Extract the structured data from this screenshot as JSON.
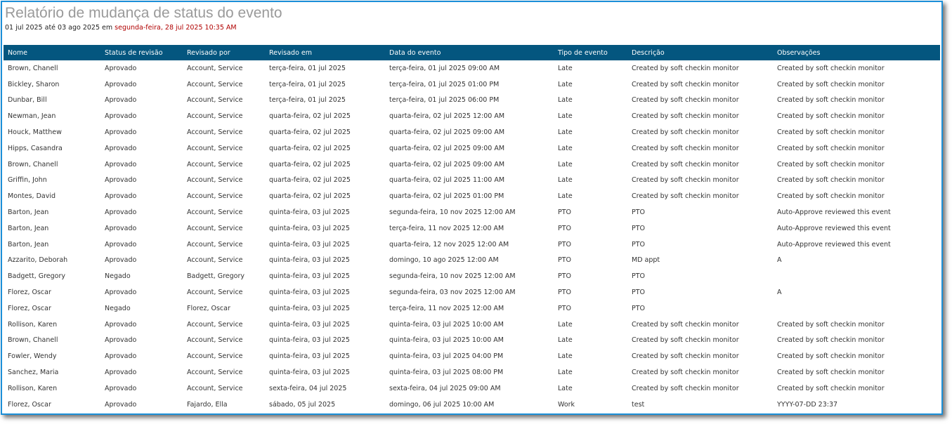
{
  "report": {
    "title": "Relatório de mudança de status do evento",
    "period": "01 jul 2025 até 03 ago 2025 em",
    "generated": "segunda-feira, 28 jul 2025 10:35 AM"
  },
  "colors": {
    "header_bg": "#04567f",
    "frame_border": "#1b8fd8",
    "generated_text": "#b00000",
    "title_text": "#9a9a9a"
  },
  "columns": [
    "Nome",
    "Status de revisão",
    "Revisado por",
    "Revisado em",
    "Data do evento",
    "Tipo de evento",
    "Descrição",
    "Observações"
  ],
  "rows": [
    [
      "Brown, Chanell",
      "Aprovado",
      "Account, Service",
      "terça-feira, 01 jul 2025",
      "terça-feira, 01 jul 2025 09:00 AM",
      "Late",
      "Created by soft checkin monitor",
      "Created by soft checkin monitor"
    ],
    [
      "Bickley, Sharon",
      "Aprovado",
      "Account, Service",
      "terça-feira, 01 jul 2025",
      "terça-feira, 01 jul 2025 01:00 PM",
      "Late",
      "Created by soft checkin monitor",
      "Created by soft checkin monitor"
    ],
    [
      "Dunbar, Bill",
      "Aprovado",
      "Account, Service",
      "terça-feira, 01 jul 2025",
      "terça-feira, 01 jul 2025 06:00 PM",
      "Late",
      "Created by soft checkin monitor",
      "Created by soft checkin monitor"
    ],
    [
      "Newman, Jean",
      "Aprovado",
      "Account, Service",
      "quarta-feira, 02 jul 2025",
      "quarta-feira, 02 jul 2025 12:00 AM",
      "Late",
      "Created by soft checkin monitor",
      "Created by soft checkin monitor"
    ],
    [
      "Houck, Matthew",
      "Aprovado",
      "Account, Service",
      "quarta-feira, 02 jul 2025",
      "quarta-feira, 02 jul 2025 09:00 AM",
      "Late",
      "Created by soft checkin monitor",
      "Created by soft checkin monitor"
    ],
    [
      "Hipps, Casandra",
      "Aprovado",
      "Account, Service",
      "quarta-feira, 02 jul 2025",
      "quarta-feira, 02 jul 2025 09:00 AM",
      "Late",
      "Created by soft checkin monitor",
      "Created by soft checkin monitor"
    ],
    [
      "Brown, Chanell",
      "Aprovado",
      "Account, Service",
      "quarta-feira, 02 jul 2025",
      "quarta-feira, 02 jul 2025 09:00 AM",
      "Late",
      "Created by soft checkin monitor",
      "Created by soft checkin monitor"
    ],
    [
      "Griffin, John",
      "Aprovado",
      "Account, Service",
      "quarta-feira, 02 jul 2025",
      "quarta-feira, 02 jul 2025 11:00 AM",
      "Late",
      "Created by soft checkin monitor",
      "Created by soft checkin monitor"
    ],
    [
      "Montes, David",
      "Aprovado",
      "Account, Service",
      "quarta-feira, 02 jul 2025",
      "quarta-feira, 02 jul 2025 01:00 PM",
      "Late",
      "Created by soft checkin monitor",
      "Created by soft checkin monitor"
    ],
    [
      "Barton, Jean",
      "Aprovado",
      "Account, Service",
      "quinta-feira, 03 jul 2025",
      "segunda-feira, 10 nov 2025 12:00 AM",
      "PTO",
      "PTO",
      "Auto-Approve reviewed this event"
    ],
    [
      "Barton, Jean",
      "Aprovado",
      "Account, Service",
      "quinta-feira, 03 jul 2025",
      "terça-feira, 11 nov 2025 12:00 AM",
      "PTO",
      "PTO",
      "Auto-Approve reviewed this event"
    ],
    [
      "Barton, Jean",
      "Aprovado",
      "Account, Service",
      "quinta-feira, 03 jul 2025",
      "quarta-feira, 12 nov 2025 12:00 AM",
      "PTO",
      "PTO",
      "Auto-Approve reviewed this event"
    ],
    [
      "Azzarito, Deborah",
      "Aprovado",
      "Account, Service",
      "quinta-feira, 03 jul 2025",
      "domingo, 10 ago 2025 12:00 AM",
      "PTO",
      "MD appt",
      "A"
    ],
    [
      "Badgett, Gregory",
      "Negado",
      "Badgett, Gregory",
      "quinta-feira, 03 jul 2025",
      "segunda-feira, 10 nov 2025 12:00 AM",
      "PTO",
      "PTO",
      ""
    ],
    [
      "Florez, Oscar",
      "Aprovado",
      "Account, Service",
      "quinta-feira, 03 jul 2025",
      "segunda-feira, 03 nov 2025 12:00 AM",
      "PTO",
      "PTO",
      "A"
    ],
    [
      "Florez, Oscar",
      "Negado",
      "Florez, Oscar",
      "quinta-feira, 03 jul 2025",
      "terça-feira, 11 nov 2025 12:00 AM",
      "PTO",
      "PTO",
      ""
    ],
    [
      "Rollison, Karen",
      "Aprovado",
      "Account, Service",
      "quinta-feira, 03 jul 2025",
      "quinta-feira, 03 jul 2025 10:00 AM",
      "Late",
      "Created by soft checkin monitor",
      "Created by soft checkin monitor"
    ],
    [
      "Brown, Chanell",
      "Aprovado",
      "Account, Service",
      "quinta-feira, 03 jul 2025",
      "quinta-feira, 03 jul 2025 10:00 AM",
      "Late",
      "Created by soft checkin monitor",
      "Created by soft checkin monitor"
    ],
    [
      "Fowler, Wendy",
      "Aprovado",
      "Account, Service",
      "quinta-feira, 03 jul 2025",
      "quinta-feira, 03 jul 2025 04:00 PM",
      "Late",
      "Created by soft checkin monitor",
      "Created by soft checkin monitor"
    ],
    [
      "Sanchez, Maria",
      "Aprovado",
      "Account, Service",
      "quinta-feira, 03 jul 2025",
      "quinta-feira, 03 jul 2025 08:00 PM",
      "Late",
      "Created by soft checkin monitor",
      "Created by soft checkin monitor"
    ],
    [
      "Rollison, Karen",
      "Aprovado",
      "Account, Service",
      "sexta-feira, 04 jul 2025",
      "sexta-feira, 04 jul 2025 09:00 AM",
      "Late",
      "Created by soft checkin monitor",
      "Created by soft checkin monitor"
    ],
    [
      "Florez, Oscar",
      "Aprovado",
      "Fajardo, Ella",
      "sábado, 05 jul 2025",
      "domingo, 06 jul 2025 10:00 AM",
      "Work",
      "test",
      "YYYY-07-DD 23:37"
    ]
  ]
}
